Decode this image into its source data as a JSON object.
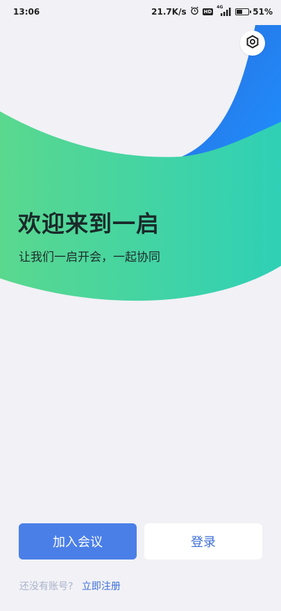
{
  "status_bar": {
    "time": "13:06",
    "net_speed": "21.7K/s",
    "hd": "HD",
    "signal_type": "4G",
    "battery_level": 0.51,
    "battery_text": "51%"
  },
  "icons": {
    "alarm": "alarm-icon",
    "signal": "signal-icon",
    "battery": "battery-icon",
    "settings": "settings-icon"
  },
  "hero": {
    "title": "欢迎来到一启",
    "subtitle": "让我们一启开会，一起协同"
  },
  "actions": {
    "join_label": "加入会议",
    "login_label": "登录"
  },
  "register": {
    "prompt": "还没有账号?",
    "link": "立即注册"
  },
  "colors": {
    "background": "#f1f1f6",
    "green_start": "#5ad88e",
    "green_end": "#2fd0b6",
    "blue_dark": "#2b6fde",
    "blue_light": "#1e90ff",
    "primary": "#4a7fe8",
    "link": "#3e6fd8"
  }
}
